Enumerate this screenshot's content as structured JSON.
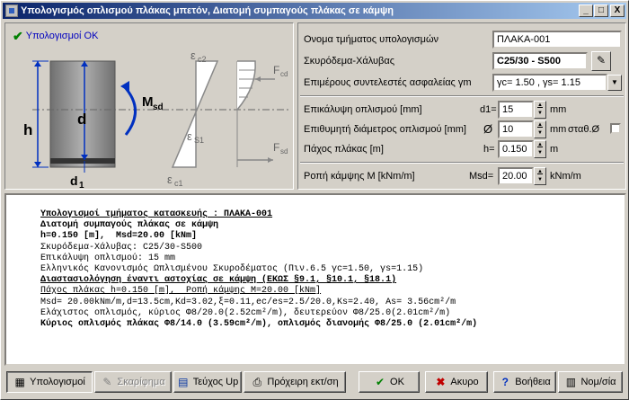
{
  "window": {
    "title": "Υπολογισμός οπλισμού πλάκας μπετόν, Διατομή συμπαγούς πλάκας σε κάμψη",
    "min": "_",
    "max": "□",
    "close": "X"
  },
  "status": {
    "text": "Υπολογισμοί ΟΚ"
  },
  "diagram": {
    "h": "h",
    "d": "d",
    "d1": "d",
    "d1_sub": "1",
    "msd": "M",
    "msd_sub": "sd",
    "ec2": "ε",
    "ec2_sub": "c2",
    "es1": "ε",
    "es1_sub": "S1",
    "ec1": "ε",
    "ec1_sub": "c1",
    "fcd": "F",
    "fcd_sub": "cd",
    "fsd": "F",
    "fsd_sub": "sd"
  },
  "form": {
    "name_label": "Ονομα τμήματος υπολογισμών",
    "name_value": "ΠΛΑΚΑ-001",
    "material_label": "Σκυρόδεμα-Χάλυβας",
    "material_value": "C25/30 - S500",
    "safety_label": "Επιμέρους συντελεστές ασφαλείας γm",
    "safety_value": "γc= 1.50 , γs= 1.15",
    "cover_label": "Επικάλυψη οπλισμού [mm]",
    "cover_prefix": "d1=",
    "cover_value": "15",
    "cover_unit": "mm",
    "diam_label": "Επιθυμητή διάμετρος οπλισμού [mm]",
    "diam_prefix": "Ø",
    "diam_value": "10",
    "diam_unit": "mm",
    "diam_const": "σταθ.Ø",
    "thick_label": "Πάχος πλάκας [m]",
    "thick_prefix": "h=",
    "thick_value": "0.150",
    "thick_unit": "m",
    "moment_label": "Ροπή κάμψης M [kNm/m]",
    "moment_prefix": "Msd=",
    "moment_value": "20.00",
    "moment_unit": "kNm/m"
  },
  "report": {
    "l1": "Υπολογισμοί τμήματος κατασκευής : ΠΛΑΚΑ-001",
    "l2": "Διατομή συμπαγούς πλάκας σε κάμψη",
    "l3": "h=0.150 [m],  Msd=20.00 [kNm]",
    "l4": "Σκυρόδεμα-Χάλυβας: C25/30-S500",
    "l5": "Επικάλυψη οπλισμού: 15 mm",
    "l6": "Ελληνικός Κανονισμός Ωπλισμένου Σκυροδέματος (Πιν.6.5 γc=1.50, γs=1.15)",
    "l7": "Διαστασιολόγηση έναντι αστοχίας σε κάμψη (ΕΚΩΣ §9.1, §10.1, §18.1)",
    "l8": "Πάχος πλάκας h=0.150 [m],  Ροπή κάμψης M=20.00 [kNm]",
    "l9": "Msd= 20.00kNm/m,d=13.5cm,Kd=3.02,ξ=0.11,ec/es=2.5/20.0,Ks=2.40, As= 3.56cm²/m",
    "l10": "Ελάχιστος οπλισμός, κύριος Φ8/20.0(2.52cm²/m), δευτερεύον Φ8/25.0(2.01cm²/m)",
    "l11": "Κύριος οπλισμός πλάκας Φ8/14.0 (3.59cm²/m), οπλισμός διανομής Φ8/25.0 (2.01cm²/m)"
  },
  "buttons": {
    "calc": "Υπολογισμοί",
    "sketch": "Σκαρίφημα",
    "report": "Τεύχος Up",
    "draft": "Πρόχειρη εκτ/ση",
    "ok": "OK",
    "cancel": "Ακυρο",
    "help": "Βοήθεια",
    "units": "Νομ/σία"
  }
}
